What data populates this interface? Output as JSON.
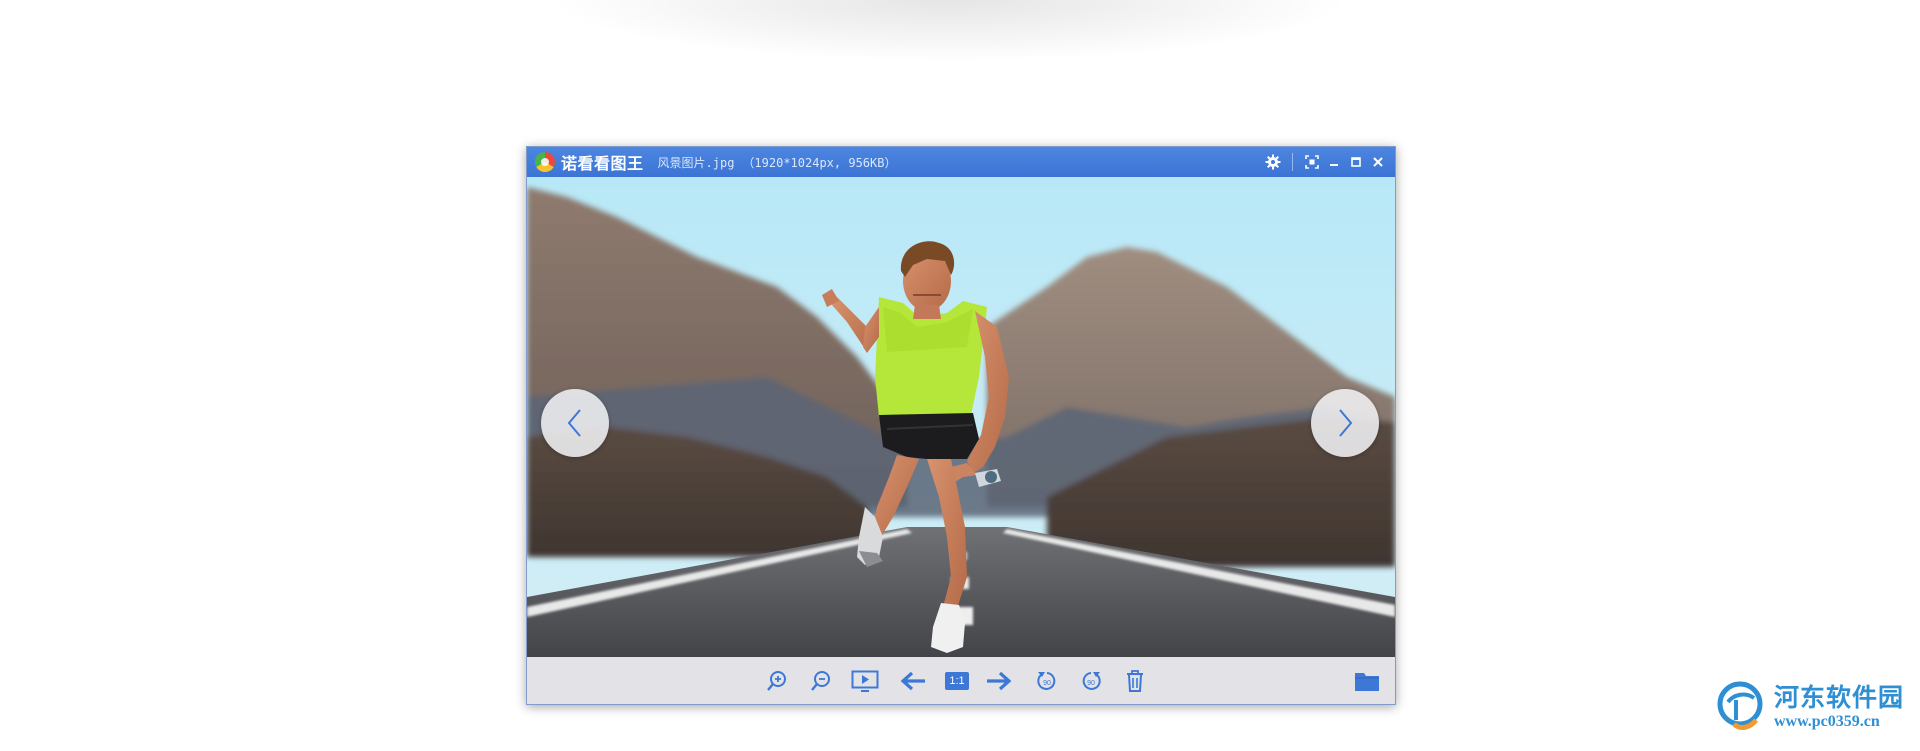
{
  "window": {
    "app_title": "诺看看图王",
    "file_name": "风景图片.jpg",
    "file_meta": "（1920*1024px, 956KB）"
  },
  "titlebar_icons": [
    "gear-icon",
    "fullscreen-icon",
    "minimize-icon",
    "maximize-icon",
    "close-icon"
  ],
  "toolbar": {
    "one_to_one_label": "1:1",
    "rotate_left_label": "90",
    "rotate_right_label": "90",
    "icons": [
      "zoom-in-icon",
      "zoom-out-icon",
      "slideshow-icon",
      "arrow-left-icon",
      "one-to-one-icon",
      "arrow-right-icon",
      "rotate-left-icon",
      "rotate-right-icon",
      "trash-icon",
      "folder-icon"
    ]
  },
  "photo": {
    "description_icon": "runner-photo"
  },
  "watermark": {
    "title": "河东软件园",
    "url": "www.pc0359.cn"
  },
  "colors": {
    "titlebar": "#4580dc",
    "accent": "#3d78d6",
    "toolbar_bg": "#e2e2e6",
    "watermark": "#2f8fd4"
  }
}
